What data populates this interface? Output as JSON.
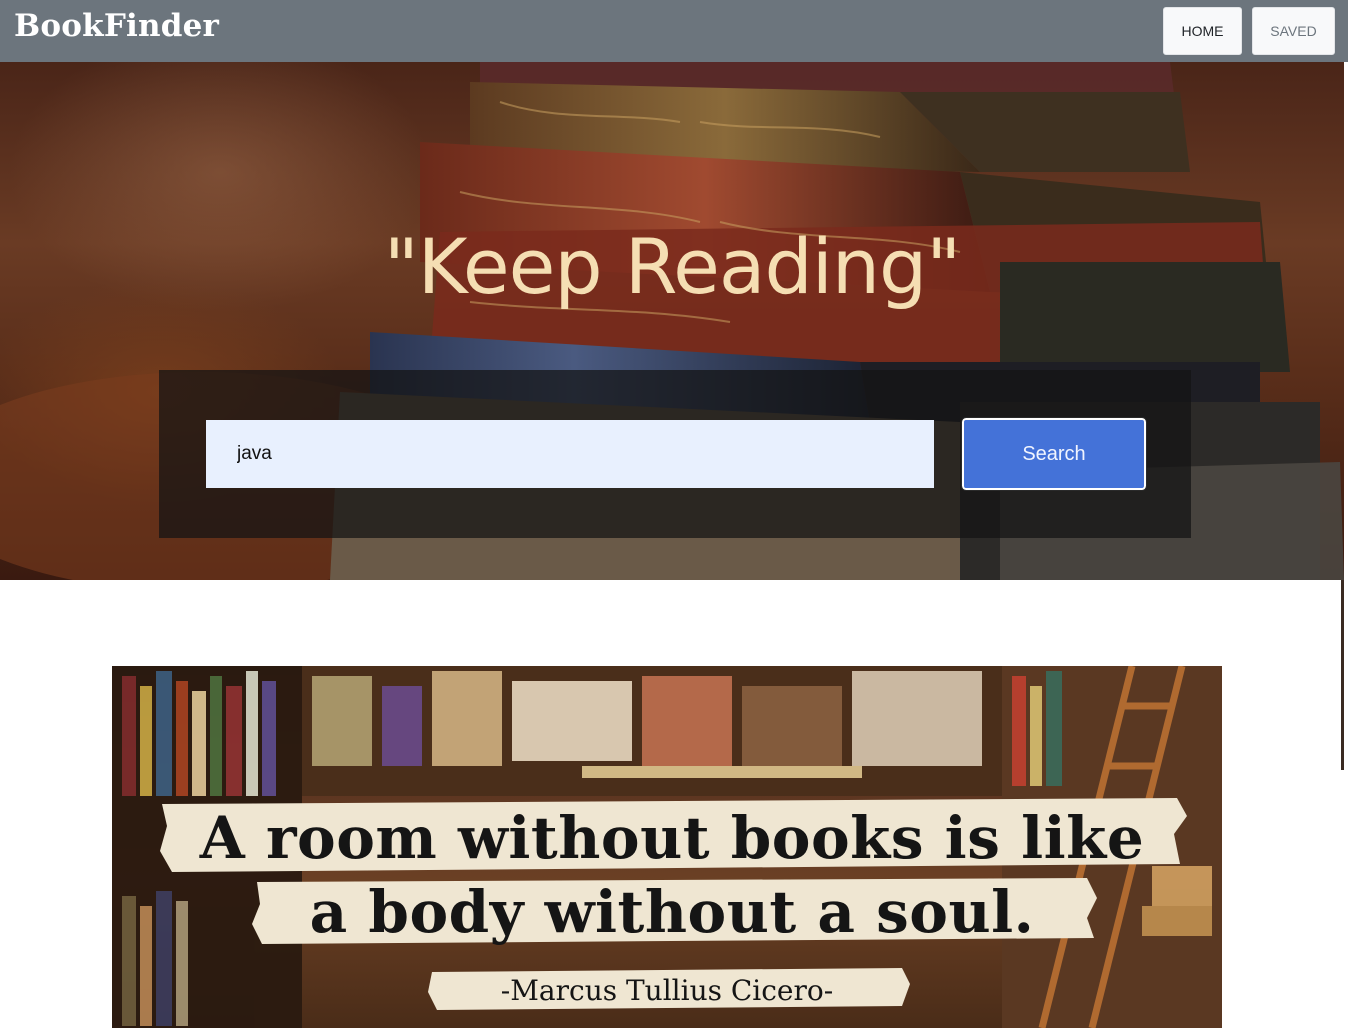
{
  "navbar": {
    "brand": "BookFinder",
    "home_label": "HOME",
    "saved_label": "SAVED"
  },
  "hero": {
    "title": "\"Keep Reading\"",
    "search_value": "java",
    "search_button_label": "Search"
  },
  "quote_image": {
    "line1": "A room without books is like",
    "line2": "a body without a soul.",
    "line3": "-Marcus Tullius Cicero-"
  }
}
